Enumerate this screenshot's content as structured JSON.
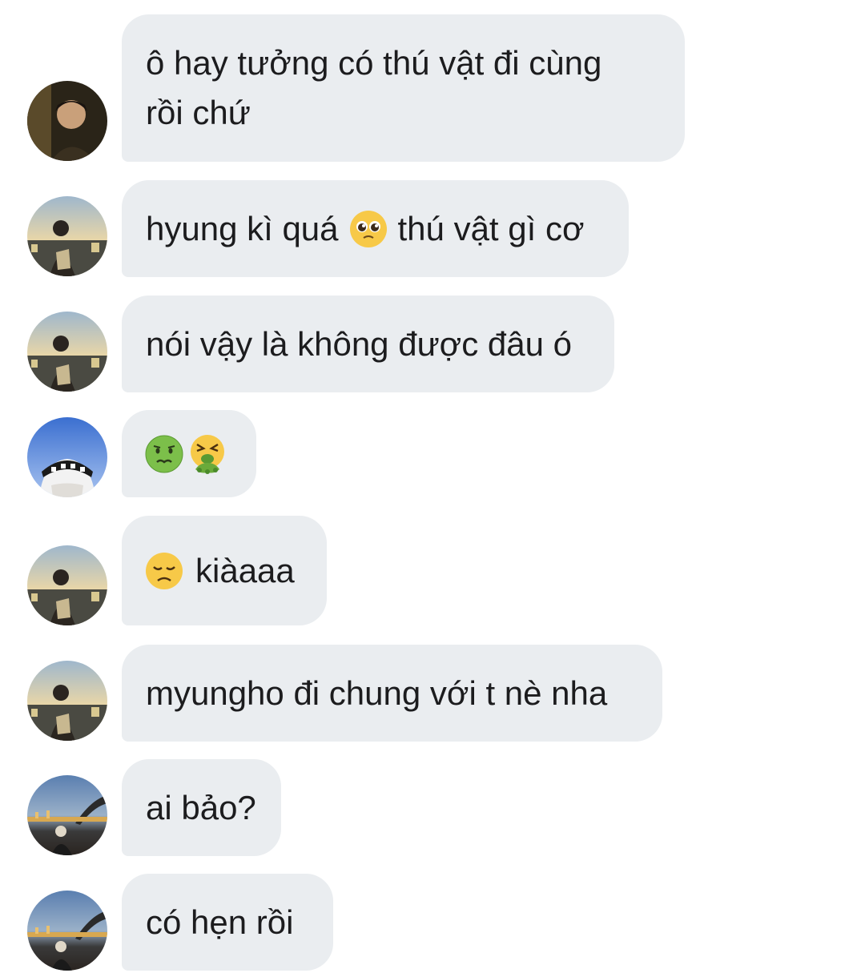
{
  "messages": [
    {
      "sender": "user-a",
      "text": "ô hay tưởng có thú vật đi cùng rồi chứ"
    },
    {
      "sender": "user-b",
      "text_before": "hyung kì quá",
      "emoji": "pleading-face-icon",
      "text_after": "thú vật gì cơ"
    },
    {
      "sender": "user-b",
      "text": "nói vậy là không được đâu ó"
    },
    {
      "sender": "user-c",
      "emojis": [
        "nauseated-face-icon",
        "vomiting-face-icon"
      ]
    },
    {
      "sender": "user-b",
      "emoji": "disappointed-face-icon",
      "text_after": "kiàaaa"
    },
    {
      "sender": "user-b",
      "text": "myungho đi chung với t nè nha"
    },
    {
      "sender": "user-d",
      "text": "ai bảo?"
    },
    {
      "sender": "user-d",
      "text": "có hẹn rồi"
    }
  ],
  "colors": {
    "bubble_bg": "#eaedf0",
    "text": "#1c1c1e",
    "background": "#ffffff"
  }
}
